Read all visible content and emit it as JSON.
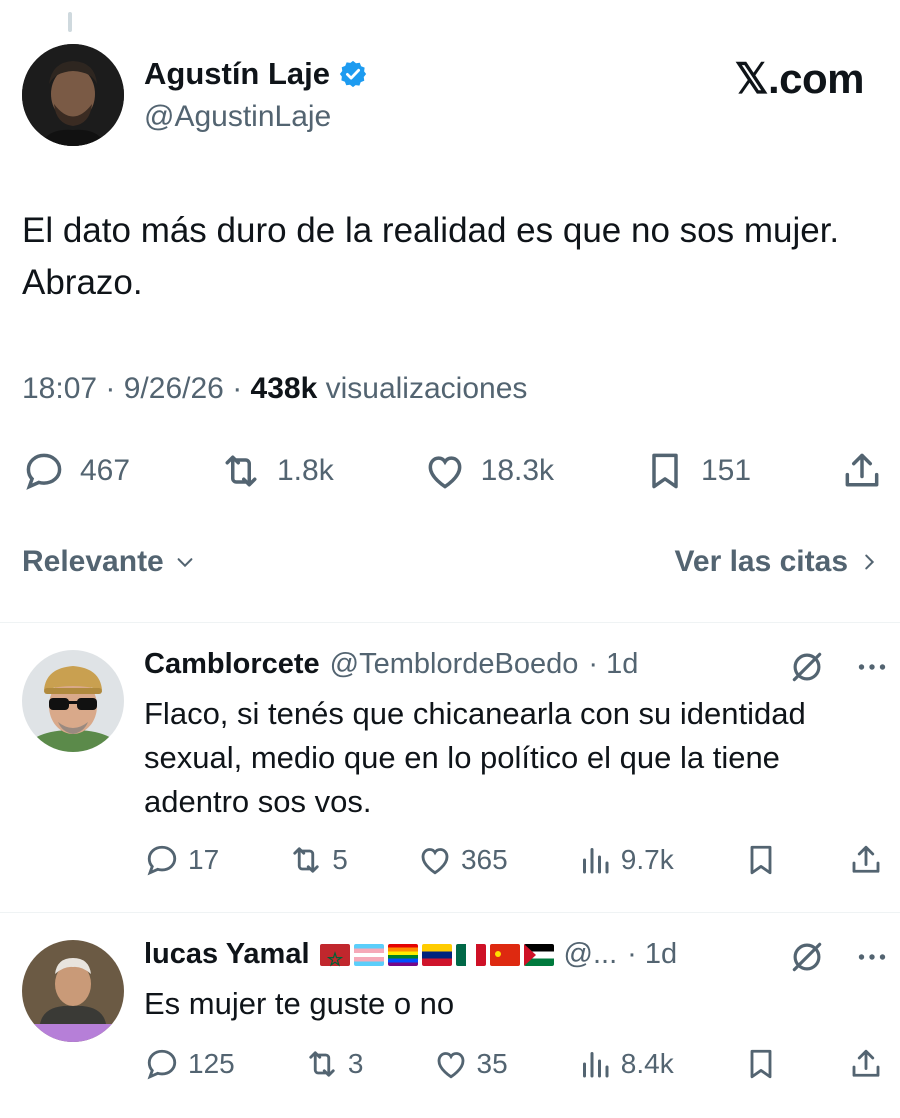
{
  "author": {
    "name": "Agustín Laje",
    "handle": "@AgustinLaje",
    "verified": true
  },
  "brand": "𝕏.com",
  "tweet": {
    "text": "El dato más duro de la realidad es que no sos mujer. Abrazo.",
    "time": "18:07",
    "date": "9/26/26",
    "views": "438k",
    "views_label": "visualizaciones",
    "replies": "467",
    "retweets": "1.8k",
    "likes": "18.3k",
    "bookmarks": "151"
  },
  "sort": {
    "label": "Relevante",
    "quotes_label": "Ver las citas"
  },
  "replies": [
    {
      "name": "Camblorcete",
      "handle": "@TemblordeBoedo",
      "age": "· 1d",
      "text": "Flaco, si tenés que chicanearla con su identidad sexual, medio que en lo político el que la tiene adentro sos vos.",
      "replies": "17",
      "retweets": "5",
      "likes": "365",
      "views": "9.7k"
    },
    {
      "name": "lucas Yamal",
      "handle": "@...",
      "age": "· 1d",
      "text": "Es mujer te guste o no",
      "replies": "125",
      "retweets": "3",
      "likes": "35",
      "views": "8.4k",
      "flags": [
        "morocco",
        "trans",
        "rainbow",
        "venezuela",
        "mexico",
        "china",
        "palestine"
      ]
    }
  ],
  "colors": {
    "text": "#0f1419",
    "secondary": "#536471",
    "verified": "#1d9bf0",
    "divider": "#eff3f4"
  }
}
